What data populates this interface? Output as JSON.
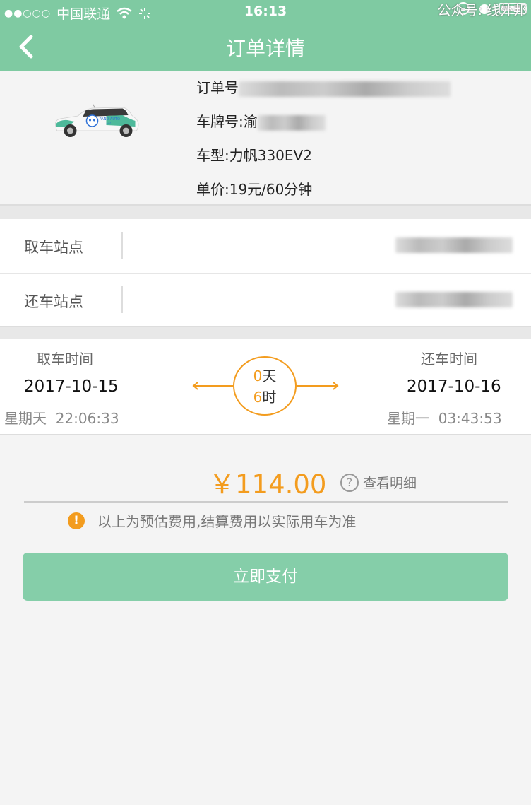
{
  "status_bar": {
    "signal": "●●○○○",
    "carrier": "中国联通",
    "time": "16:13",
    "watermark": "公众号: 线外邦"
  },
  "nav": {
    "title": "订单详情"
  },
  "order": {
    "order_no_label": "订单号",
    "plate_label": "车牌号:渝",
    "model": "车型:力帆330EV2",
    "price_rate": "单价:19元/60分钟"
  },
  "stations": {
    "pickup_label": "取车站点",
    "return_label": "还车站点"
  },
  "times": {
    "pickup_label": "取车时间",
    "pickup_date": "2017-10-15",
    "pickup_week": "星期天",
    "pickup_clock": "22:06:33",
    "return_label": "还车时间",
    "return_date": "2017-10-16",
    "return_week": "星期一",
    "return_clock": "03:43:53",
    "duration_days": "0",
    "days_unit": "天",
    "duration_hours": "6",
    "hours_unit": "时"
  },
  "price": {
    "amount": "￥114.00",
    "detail_link": "查看明细",
    "notice": "以上为预估费用,结算费用以实际用车为准"
  },
  "pay_button": "立即支付",
  "colors": {
    "brand_green": "#7fcaa2",
    "accent_orange": "#f39c1e",
    "button_green": "#85cea9"
  }
}
